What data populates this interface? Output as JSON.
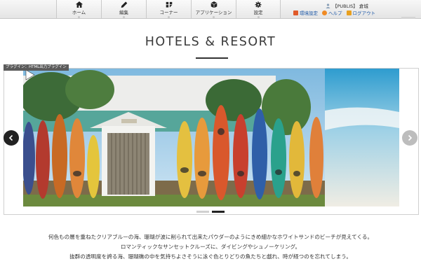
{
  "admin": {
    "nav": [
      {
        "label": "ホーム",
        "icon": "home-icon"
      },
      {
        "label": "編集",
        "icon": "pencil-icon"
      },
      {
        "label": "コーナー",
        "icon": "corner-icon"
      },
      {
        "label": "アプリケーション",
        "icon": "cube-icon"
      },
      {
        "label": "設定",
        "icon": "gear-icon"
      }
    ],
    "user": {
      "name": "【PUBLIS】 倉城",
      "links": [
        {
          "label": "環境設定",
          "color": "#e05a2a"
        },
        {
          "label": "ヘルプ",
          "color": "#f08a24"
        },
        {
          "label": "ログアウト",
          "color": "#e8a020"
        }
      ]
    }
  },
  "page": {
    "title": "HOTELS & RESORT",
    "plugin_label": "プラグイン：HTML出力プラグイン",
    "slider": {
      "pages": 2,
      "active_page": 2,
      "image_icon": "play-icon"
    },
    "body_lines": [
      "何色もの層を重ねたクリアブルーの海、珊瑚が波に削られて出来たパウダーのようにきめ細かなホワイトサンドのビーチが見えてくる。",
      "ロマンティックなサンセットクルーズに、ダイビングやシュノーケリング。",
      "抜群の透明度を誇る海、珊瑚礁の中を気持ちよさそうに泳ぐ色とりどりの魚たちと戯れ、時が経つのを忘れてしまう。"
    ]
  },
  "colors": {
    "link": "#1a56a6",
    "arrow_active": "#222222",
    "arrow_inactive": "#bdbdbd"
  }
}
